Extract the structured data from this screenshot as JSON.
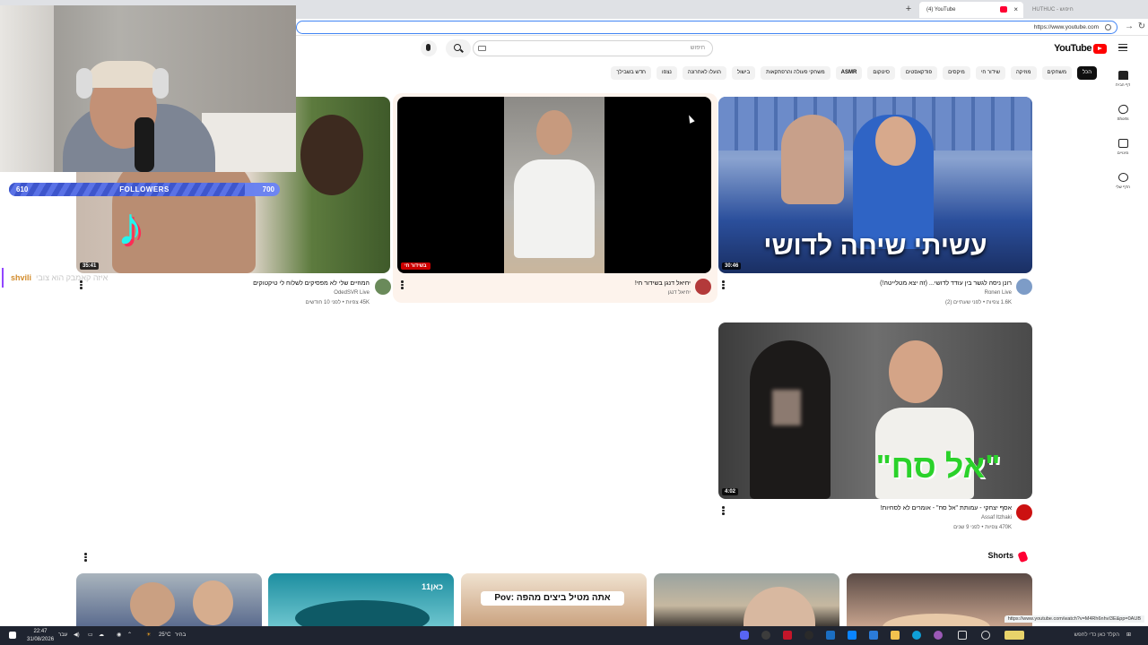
{
  "browser": {
    "tabs": [
      {
        "label": "(4) YouTube",
        "active": true
      },
      {
        "label": "HUTHUC - חיפוש",
        "active": false
      }
    ],
    "new_tab_icon": "plus-icon",
    "url": "https://www.youtube.com"
  },
  "youtube": {
    "logo_text": "YouTube",
    "search_placeholder": "חיפוש",
    "chips": [
      "הכל",
      "משחקים",
      "מוזיקה",
      "שידור חי",
      "מיקסים",
      "פודקאסטים",
      "סיטקום",
      "ASMR",
      "משחקי פעולה והרפתקאות",
      "בישול",
      "הועלו לאחרונה",
      "נצפו",
      "חדש בשבילך"
    ],
    "sidebar": [
      {
        "label": "דף הבית",
        "icon": "home-icon"
      },
      {
        "label": "Shorts",
        "icon": "shorts-icon"
      },
      {
        "label": "מינויים",
        "icon": "subscriptions-icon"
      },
      {
        "label": "הדף שלי",
        "icon": "you-icon"
      }
    ],
    "videos": [
      {
        "title": "רונן ניסה לגשר בין עודד לדושי... (זה יצא מטלייטה!)",
        "channel": "Ronen Live",
        "meta": "1.6K צפיות • לפני שעתיים (2)",
        "duration": "30:46",
        "overlay_text": "עשיתי שיחה לדושי"
      },
      {
        "title": "יחיאל דנגן בשידור חי!",
        "channel": "יחיאל דנגן",
        "meta": "",
        "live_label": "בשידור חי"
      },
      {
        "title": "המוזיים שלי לא מפסיקים לשלוח לי טיקטוקים",
        "channel": "OdedSVR Live",
        "meta": "45K צפיות • לפני 10 חודשים",
        "duration": "35:41"
      },
      {
        "title": "אסף יצחקי - עמותת \"אל סח\" - אומרים לא לסחיות!",
        "channel": "Assaf Itzhaki",
        "meta": "470K צפיות • לפני 9 שנים",
        "duration": "4:02",
        "overlay_text": "\"אל סח\""
      }
    ],
    "shorts": {
      "title": "Shorts",
      "items": [
        {
          "overlay": ""
        },
        {
          "overlay": "כאן11"
        },
        {
          "overlay": "Pov: אתה מטיל ביצים מהפה"
        },
        {
          "overlay": ""
        },
        {
          "overlay": ""
        }
      ]
    },
    "status_url": "https://www.youtube.com/watch?v=M4Rh6nhvI3E&pp=0AUB"
  },
  "stream_overlay": {
    "followers_current": "610",
    "followers_goal": "700",
    "followers_label": "FOLLOWERS",
    "followers_progress": 0.871,
    "chat_user": "shvili",
    "chat_text": "איזה קאמבק הוא צובי"
  },
  "taskbar": {
    "time": "22:47",
    "date": "31/08/2026",
    "lang": "עבר",
    "weather": "25°C",
    "weather_label": "בהיר",
    "search_text": "הקלד כאן כדי לחפש"
  }
}
